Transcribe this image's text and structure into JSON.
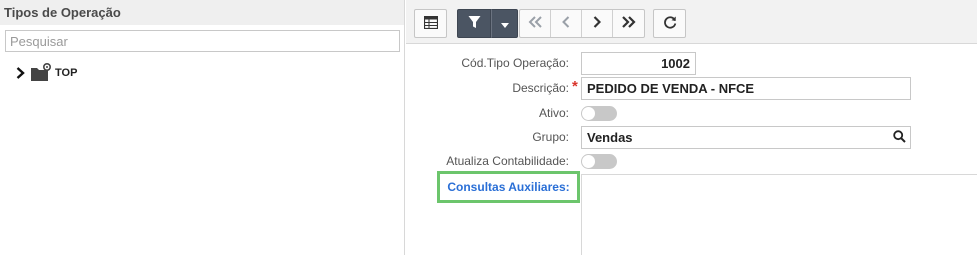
{
  "left_panel": {
    "title": "Tipos de Operação",
    "search_placeholder": "Pesquisar",
    "tree": [
      {
        "label": "TOP",
        "icon": "folder-gear-icon",
        "expander": "chevron-right-icon"
      }
    ]
  },
  "toolbar": {
    "buttons": [
      {
        "name": "grid-view-button",
        "icon": "grid-icon"
      },
      {
        "name": "filter-button",
        "icon": "filter-icon"
      },
      {
        "name": "filter-dropdown-button",
        "icon": "caret-down-icon"
      },
      {
        "name": "first-record-button",
        "icon": "double-chevron-left-icon"
      },
      {
        "name": "previous-record-button",
        "icon": "chevron-left-icon"
      },
      {
        "name": "next-record-button",
        "icon": "chevron-right-icon"
      },
      {
        "name": "last-record-button",
        "icon": "double-chevron-right-icon"
      },
      {
        "name": "refresh-button",
        "icon": "refresh-icon"
      }
    ]
  },
  "form": {
    "cod_tipo_operacao": {
      "label": "Cód.Tipo Operação:",
      "value": "1002"
    },
    "descricao": {
      "label": "Descrição:",
      "required_mark": "*",
      "value": "PEDIDO DE VENDA - NFCE"
    },
    "ativo": {
      "label": "Ativo:",
      "on": false
    },
    "grupo": {
      "label": "Grupo:",
      "value": "Vendas",
      "icon": "search-icon"
    },
    "atualiza_contabilidade": {
      "label": "Atualiza Contabilidade:",
      "on": false
    },
    "consultas_auxiliares": {
      "label": "Consultas Auxiliares:"
    }
  },
  "colors": {
    "toolbar_active": "#4b5563",
    "link_blue": "#2a6fd6",
    "highlight_green": "#6cc56c",
    "required_red": "#d9342b"
  }
}
